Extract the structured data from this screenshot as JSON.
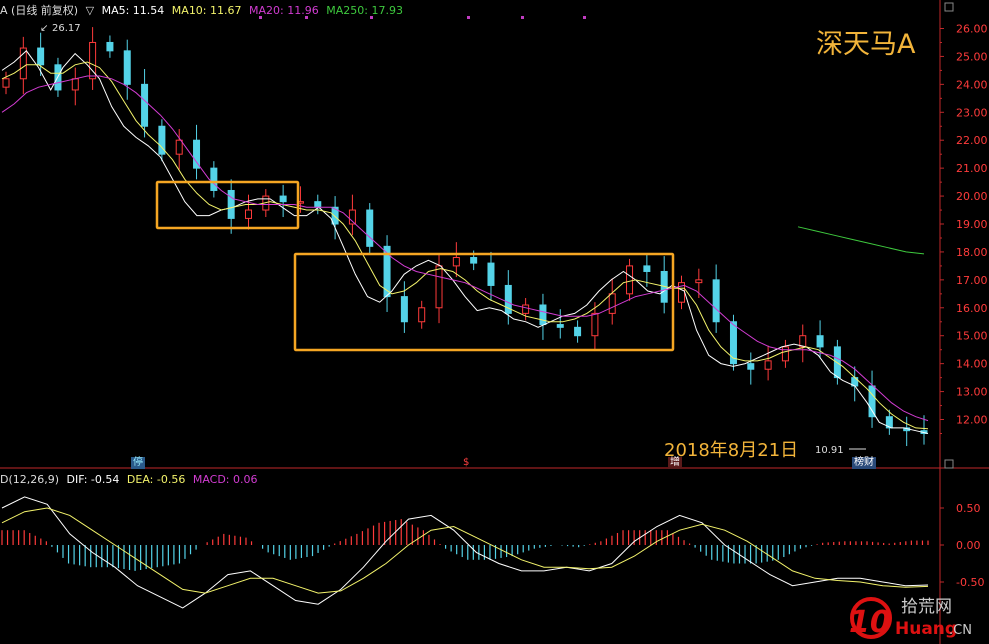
{
  "header": {
    "name": "A (日线 前复权)",
    "ma5": "MA5: 11.54",
    "ma10": "MA10: 11.67",
    "ma20": "MA20: 11.96",
    "ma250": "MA250: 17.93"
  },
  "stock_name": "深天马A",
  "date_note": "2018年8月21日",
  "low_note": "10.91",
  "high_note": "26.17",
  "badges": {
    "b1": "停",
    "b2": "$",
    "b3": "增",
    "b4": "榜财"
  },
  "macd_header": {
    "name": "D(12,26,9)",
    "dif": "DIF: -0.54",
    "dea": "DEA: -0.56",
    "macd": "MACD: 0.06"
  },
  "price_ticks": [
    "26.00",
    "25.00",
    "24.00",
    "23.00",
    "22.00",
    "21.00",
    "20.00",
    "19.00",
    "18.00",
    "17.00",
    "16.00",
    "15.00",
    "14.00",
    "13.00",
    "12.00"
  ],
  "macd_ticks": [
    "0.50",
    "0.00",
    "-0.50"
  ],
  "watermark": {
    "num": "10",
    "cn": "拾荒网",
    "en": "Huang",
    "tld": ".CN"
  },
  "colors": {
    "up": "#ff3b3b",
    "down": "#54d3e8",
    "ma5": "#ffffff",
    "ma10": "#f3f36b",
    "ma20": "#d23cd2",
    "ma250": "#3ec93e",
    "box": "#f5a623",
    "axis": "#c0282a"
  },
  "chart_data": [
    {
      "type": "candlestick",
      "title": "深天马A",
      "series": [
        {
          "name": "MA5",
          "values": [
            24.5,
            24.8,
            25.2,
            24.6,
            23.8,
            24.6,
            25.1,
            24.7,
            24.2,
            23.2,
            22.5,
            22.1,
            21.8,
            21.4,
            20.6,
            19.8,
            19.3,
            19.3,
            19.5,
            19.6,
            19.8,
            19.9,
            19.9,
            19.6,
            19.3,
            19.3,
            19.6,
            19.2,
            18.2,
            17.2,
            16.4,
            16.2,
            16.6,
            17.2,
            17.5,
            17.7,
            17.5,
            17.0,
            16.4,
            15.9,
            16.0,
            15.9,
            15.6,
            15.5,
            15.3,
            15.5,
            15.7,
            15.8,
            16.1,
            16.6,
            17.0,
            17.3,
            17.0,
            16.6,
            16.5,
            16.8,
            16.6,
            15.2,
            14.3,
            14.0,
            13.9,
            14.0,
            14.2,
            14.4,
            14.6,
            14.7,
            14.6,
            14.3,
            13.7,
            13.4,
            13.2,
            12.6,
            11.9,
            11.7,
            11.7,
            11.6,
            11.5
          ]
        },
        {
          "name": "MA10",
          "values": [
            24.2,
            24.4,
            24.7,
            24.7,
            24.4,
            24.4,
            24.7,
            24.8,
            24.6,
            24.1,
            23.4,
            22.7,
            22.2,
            21.8,
            21.3,
            20.6,
            20.1,
            19.7,
            19.5,
            19.6,
            19.7,
            19.7,
            19.8,
            19.7,
            19.6,
            19.5,
            19.5,
            19.4,
            19.0,
            18.4,
            17.6,
            16.8,
            16.5,
            16.6,
            16.9,
            17.3,
            17.4,
            17.3,
            17.0,
            16.6,
            16.3,
            16.1,
            15.9,
            15.7,
            15.6,
            15.5,
            15.5,
            15.6,
            15.8,
            16.1,
            16.5,
            16.9,
            17.0,
            16.9,
            16.8,
            16.7,
            16.7,
            16.1,
            15.2,
            14.6,
            14.2,
            14.1,
            14.1,
            14.2,
            14.4,
            14.5,
            14.6,
            14.5,
            14.2,
            13.9,
            13.5,
            13.1,
            12.6,
            12.2,
            11.9,
            11.7,
            11.67
          ]
        },
        {
          "name": "MA20",
          "values": [
            23.0,
            23.3,
            23.7,
            23.9,
            24.0,
            24.1,
            24.2,
            24.3,
            24.3,
            24.2,
            24.0,
            23.7,
            23.3,
            22.9,
            22.4,
            21.8,
            21.2,
            20.6,
            20.2,
            19.9,
            19.8,
            19.7,
            19.7,
            19.7,
            19.7,
            19.6,
            19.6,
            19.6,
            19.4,
            19.0,
            18.6,
            18.2,
            17.8,
            17.5,
            17.3,
            17.2,
            17.1,
            17.0,
            16.9,
            16.7,
            16.5,
            16.3,
            16.1,
            16.0,
            15.9,
            15.8,
            15.7,
            15.7,
            15.7,
            15.8,
            16.0,
            16.2,
            16.4,
            16.5,
            16.6,
            16.7,
            16.8,
            16.6,
            16.2,
            15.8,
            15.4,
            15.1,
            14.8,
            14.6,
            14.5,
            14.5,
            14.5,
            14.4,
            14.3,
            14.1,
            13.8,
            13.4,
            13.0,
            12.6,
            12.3,
            12.1,
            11.96
          ]
        },
        {
          "name": "MA250",
          "values": [
            18.9,
            18.75,
            18.6,
            18.45,
            18.3,
            18.15,
            18.0,
            17.93
          ]
        }
      ],
      "candles_close": [
        24.2,
        25.3,
        24.7,
        23.8,
        24.2,
        25.5,
        25.2,
        24.0,
        22.5,
        21.5,
        22.0,
        21.0,
        20.2,
        19.2,
        19.5,
        20.0,
        19.8,
        19.8,
        19.6,
        19.0,
        19.5,
        18.2,
        16.4,
        15.5,
        16.0,
        17.5,
        17.8,
        17.6,
        16.8,
        15.8,
        16.1,
        15.4,
        15.3,
        15.0,
        15.8,
        16.5,
        17.5,
        17.3,
        16.2,
        16.9,
        17.0,
        15.5,
        14.0,
        13.8,
        14.1,
        14.6,
        15.0,
        14.6,
        13.5,
        13.2,
        12.1,
        11.7,
        11.6,
        11.5
      ],
      "annotations": [
        "26.17",
        "10.91",
        "2018年8月21日"
      ],
      "ylim": [
        11.0,
        26.5
      ],
      "yticks": [
        26,
        25,
        24,
        23,
        22,
        21,
        20,
        19,
        18,
        17,
        16,
        15,
        14,
        13,
        12
      ]
    },
    {
      "type": "bar",
      "title": "MACD(12,26,9)",
      "series": [
        {
          "name": "DIF",
          "values": [
            0.5,
            0.65,
            0.55,
            0.15,
            -0.1,
            -0.3,
            -0.55,
            -0.7,
            -0.85,
            -0.65,
            -0.4,
            -0.35,
            -0.55,
            -0.75,
            -0.8,
            -0.6,
            -0.3,
            0.05,
            0.35,
            0.4,
            0.2,
            -0.1,
            -0.25,
            -0.35,
            -0.35,
            -0.3,
            -0.35,
            -0.25,
            0.05,
            0.25,
            0.4,
            0.3,
            0.0,
            -0.2,
            -0.4,
            -0.55,
            -0.5,
            -0.45,
            -0.45,
            -0.5,
            -0.55,
            -0.54
          ]
        },
        {
          "name": "DEA",
          "values": [
            0.3,
            0.45,
            0.5,
            0.4,
            0.2,
            0.0,
            -0.2,
            -0.4,
            -0.6,
            -0.65,
            -0.55,
            -0.45,
            -0.45,
            -0.55,
            -0.65,
            -0.62,
            -0.45,
            -0.25,
            0.0,
            0.2,
            0.25,
            0.1,
            -0.05,
            -0.2,
            -0.3,
            -0.3,
            -0.32,
            -0.3,
            -0.15,
            0.05,
            0.2,
            0.28,
            0.2,
            0.05,
            -0.15,
            -0.35,
            -0.45,
            -0.48,
            -0.5,
            -0.55,
            -0.57,
            -0.56
          ]
        },
        {
          "name": "MACD",
          "values": [
            0.2,
            0.2,
            0.05,
            -0.25,
            -0.3,
            -0.3,
            -0.35,
            -0.3,
            -0.25,
            0.0,
            0.15,
            0.1,
            -0.1,
            -0.2,
            -0.15,
            0.02,
            0.15,
            0.3,
            0.35,
            0.2,
            -0.05,
            -0.2,
            -0.2,
            -0.15,
            -0.05,
            0.0,
            -0.03,
            0.05,
            0.2,
            0.2,
            0.2,
            0.02,
            -0.2,
            -0.25,
            -0.25,
            -0.2,
            -0.05,
            0.03,
            0.05,
            0.05,
            0.02,
            0.06
          ]
        }
      ],
      "ylim": [
        -0.85,
        0.7
      ],
      "yticks": [
        0.5,
        0.0,
        -0.5
      ]
    }
  ]
}
